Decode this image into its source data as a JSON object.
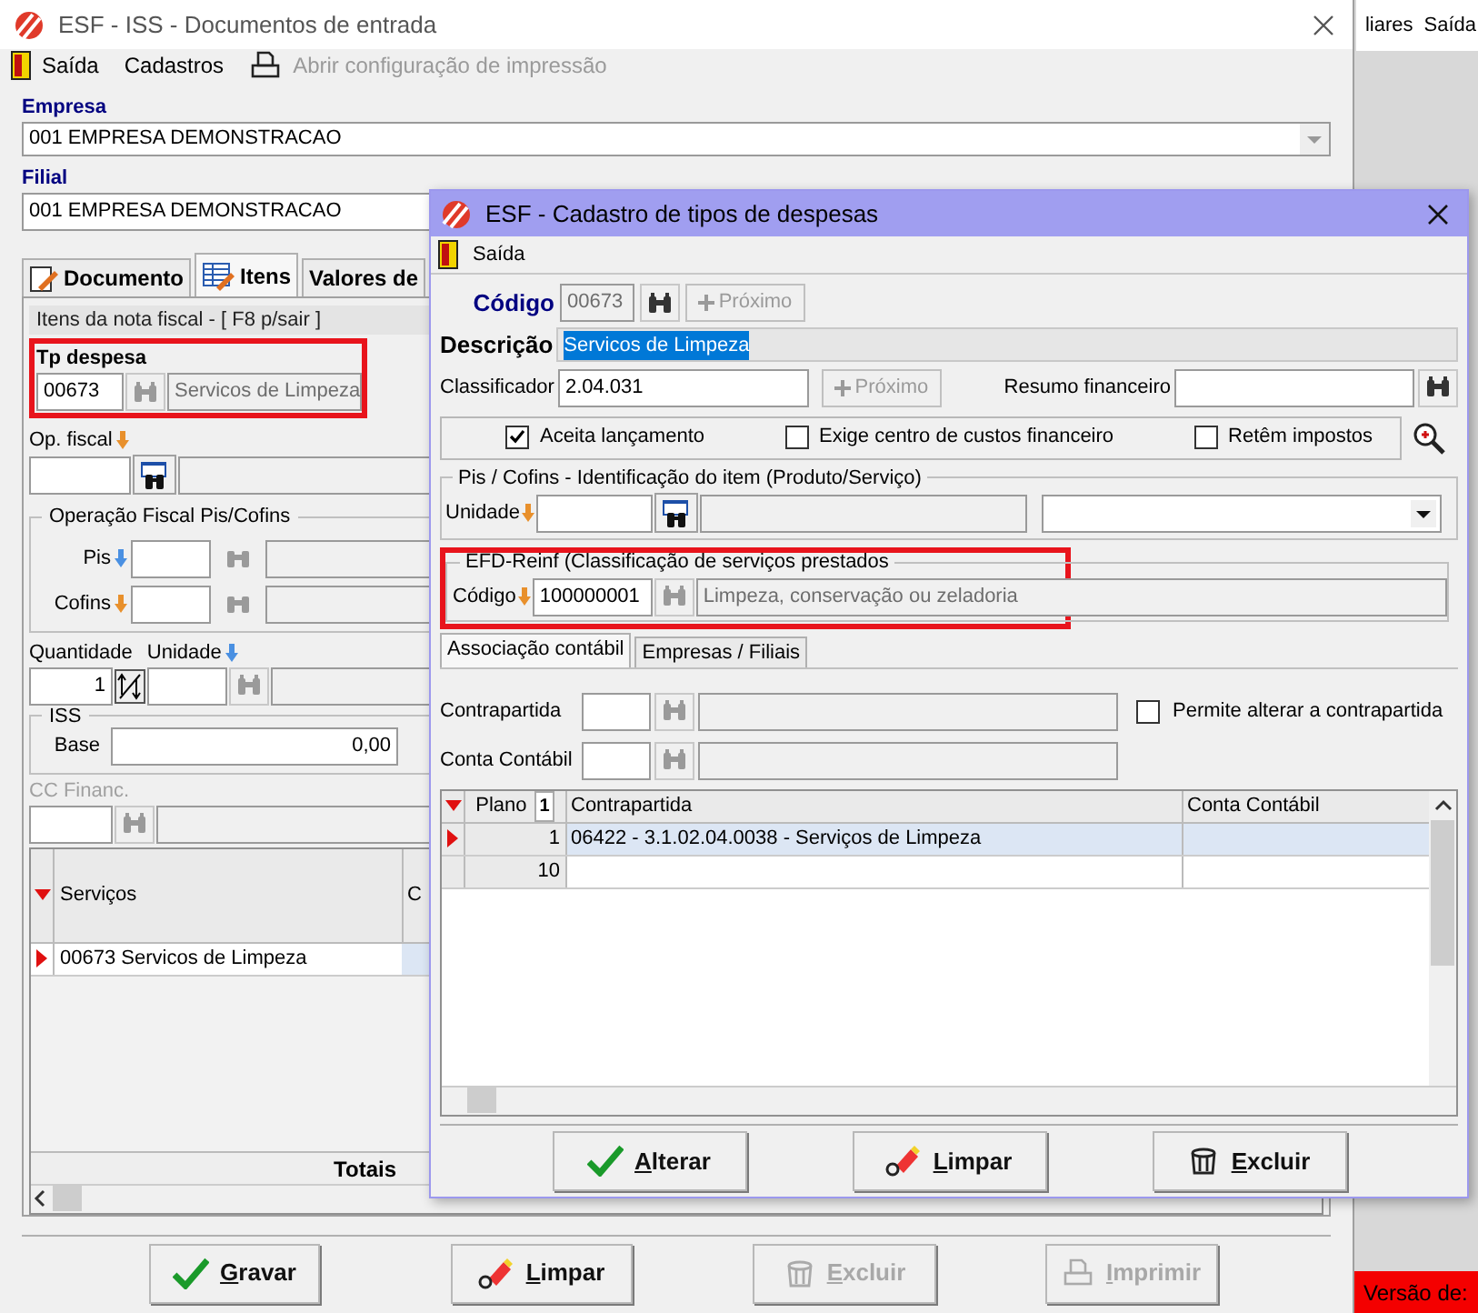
{
  "background_app": {
    "menu": [
      "liares",
      "Saída"
    ],
    "status": "Versão de:"
  },
  "main_window": {
    "title": "ESF - ISS - Documentos de entrada",
    "menu": [
      {
        "label": "Saída",
        "kind": "exit",
        "disabled": false
      },
      {
        "label": "Cadastros",
        "kind": "plain",
        "disabled": false
      },
      {
        "label": "Abrir configuração de impressão",
        "kind": "printer",
        "disabled": true
      }
    ],
    "empresa": {
      "label": "Empresa",
      "value": "001 EMPRESA DEMONSTRACAO"
    },
    "filial": {
      "label": "Filial",
      "value": "001 EMPRESA DEMONSTRACAO"
    },
    "tabs": [
      {
        "label": "Documento",
        "kind": "document",
        "selected": false
      },
      {
        "label": "Itens",
        "kind": "table",
        "selected": true
      },
      {
        "label": "Valores de",
        "kind": "plain",
        "selected": false
      }
    ],
    "items_panel": {
      "title": "Itens da nota fiscal - [ F8 p/sair ]",
      "tp_despesa": {
        "label": "Tp despesa",
        "code": "00673",
        "description": "Servicos de Limpeza"
      },
      "op_fiscal": {
        "label": "Op. fiscal"
      },
      "pis_cofins": {
        "title": "Operação Fiscal Pis/Cofins",
        "fields": [
          {
            "label": "Pis",
            "color": "#4a90e2"
          },
          {
            "label": "Cofins",
            "color": "#e8902c"
          }
        ]
      },
      "quantidade": {
        "label": "Quantidade",
        "value": "1"
      },
      "unidade": {
        "label": "Unidade"
      },
      "iss": {
        "title": "ISS",
        "base_label": "Base",
        "base_value": "0,00"
      },
      "cc_financ": {
        "label": "CC Financ.",
        "disabled": true
      },
      "grid": {
        "columns": [
          "Serviços",
          "C"
        ],
        "rows": [
          {
            "servico": "00673 Servicos de Limpeza",
            "selected": true
          }
        ],
        "totals": "Totais"
      }
    },
    "buttons": [
      {
        "label": "Gravar",
        "kind": "check",
        "disabled": false
      },
      {
        "label": "Limpar",
        "kind": "eraser",
        "disabled": false
      },
      {
        "label": "Excluir",
        "kind": "trash",
        "disabled": true
      },
      {
        "label": "Imprimir",
        "kind": "printer",
        "disabled": true
      }
    ]
  },
  "dialog": {
    "title": "ESF - Cadastro de tipos de despesas",
    "menu": [
      "Saída"
    ],
    "codigo": {
      "label": "Código",
      "value": "00673",
      "next": "Próximo"
    },
    "descricao": {
      "label": "Descrição",
      "value": "Servicos de Limpeza"
    },
    "classificador": {
      "label": "Classificador",
      "value": "2.04.031",
      "next": "Próximo"
    },
    "resumo": {
      "label": "Resumo financeiro"
    },
    "options": [
      {
        "label": "Aceita lançamento",
        "checked": true
      },
      {
        "label": "Exige centro de custos financeiro",
        "checked": false
      },
      {
        "label": "Retêm impostos",
        "checked": false
      }
    ],
    "pis_cofins": {
      "title": "Pis / Cofins - Identificação do item (Produto/Serviço)",
      "unidade_label": "Unidade"
    },
    "efd": {
      "title": "EFD-Reinf (Classificação de serviços prestados",
      "codigo_label": "Código",
      "code": "100000001",
      "description": "Limpeza, conservação ou zeladoria"
    },
    "tabs": [
      {
        "label": "Associação contábil",
        "selected": true
      },
      {
        "label": "Empresas / Filiais",
        "selected": false
      }
    ],
    "contrapartida_label": "Contrapartida",
    "conta_label": "Conta Contábil",
    "permite": {
      "label": "Permite alterar a contrapartida",
      "checked": false
    },
    "grid": {
      "columns": [
        "Plano",
        "Contrapartida",
        "Conta Contábil"
      ],
      "sort_mark": "1",
      "rows": [
        {
          "plano": "1",
          "contrapartida": "06422 - 3.1.02.04.0038 - Serviços de Limpeza",
          "selected": true
        },
        {
          "plano": "10",
          "selected": false
        }
      ]
    },
    "buttons": [
      {
        "label": "Alterar",
        "kind": "check"
      },
      {
        "label": "Limpar",
        "kind": "eraser"
      },
      {
        "label": "Excluir",
        "kind": "trash"
      }
    ]
  }
}
